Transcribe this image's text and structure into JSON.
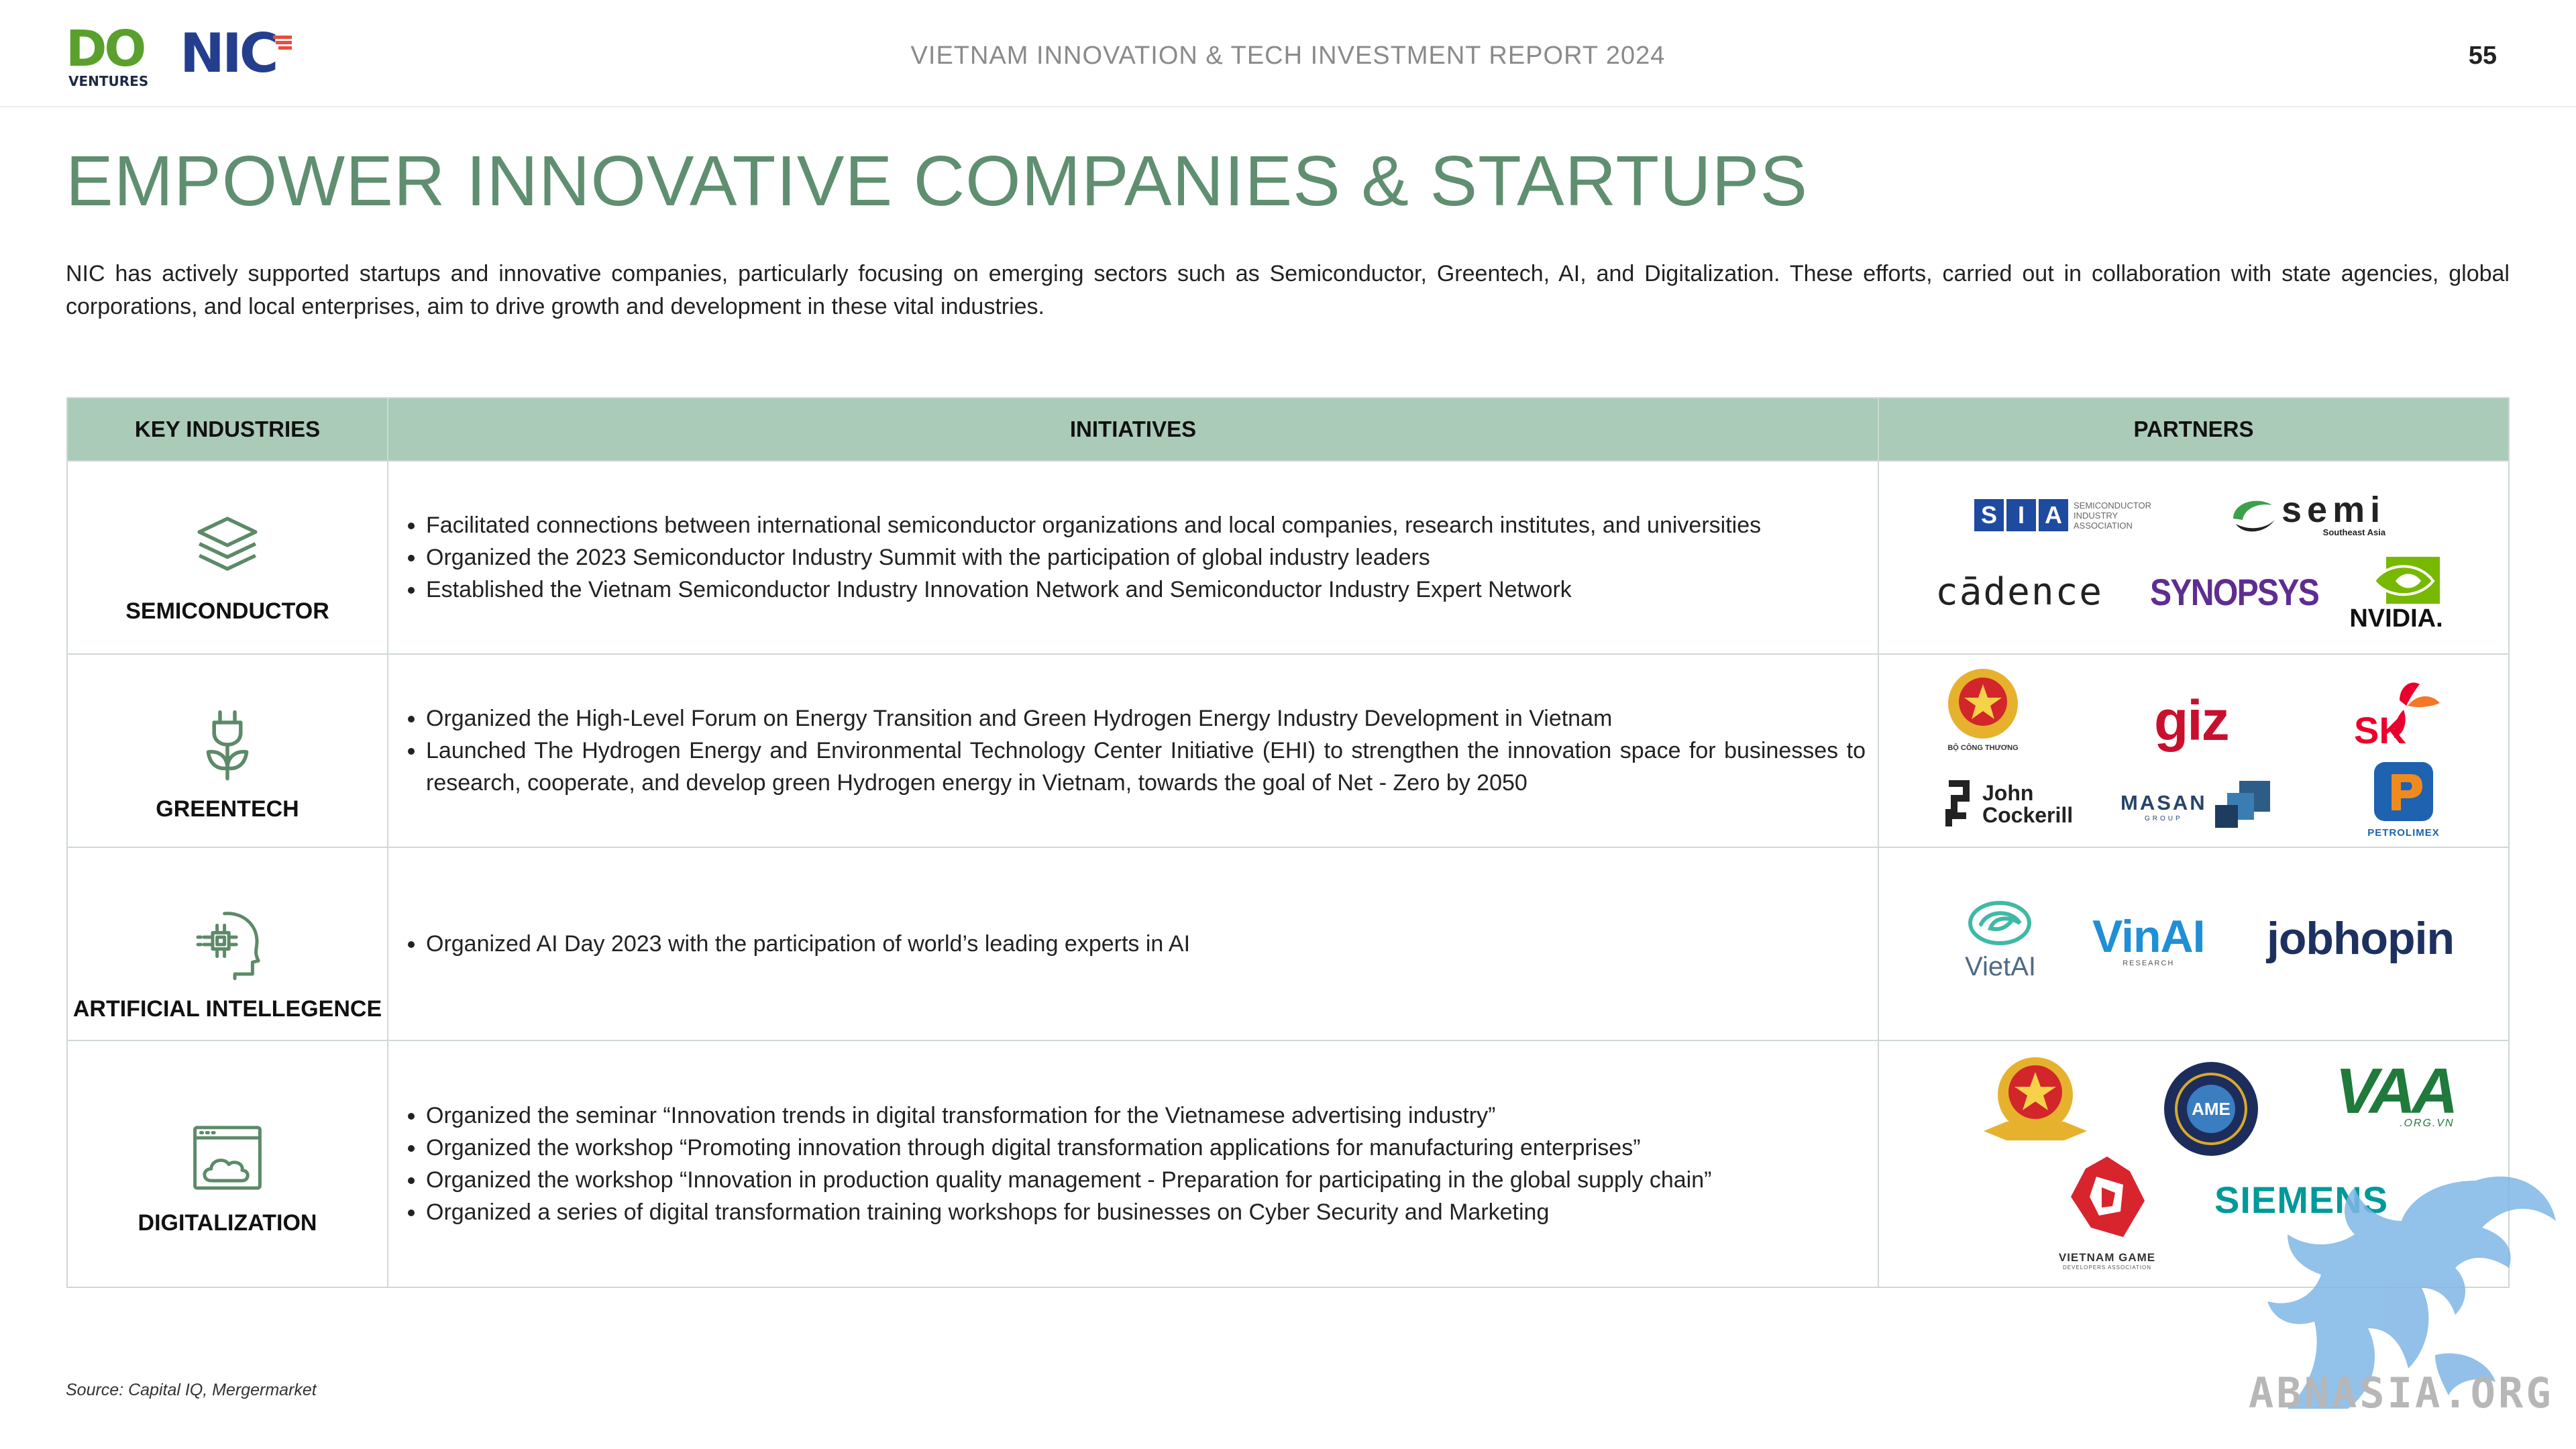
{
  "header": {
    "logo_do": "DO",
    "logo_ventures": "VENTURES",
    "logo_nic": "NIC",
    "report_title": "VIETNAM INNOVATION & TECH INVESTMENT REPORT 2024",
    "page_number": "55"
  },
  "page_title": "EMPOWER INNOVATIVE COMPANIES & STARTUPS",
  "intro": "NIC has actively supported startups and innovative companies, particularly focusing on emerging sectors such as Semiconductor, Greentech, AI, and Digitalization. These efforts, carried out in collaboration with state agencies, global corporations, and local enterprises, aim to drive growth and development in these vital industries.",
  "table": {
    "headers": [
      "KEY INDUSTRIES",
      "INITIATIVES",
      "PARTNERS"
    ],
    "rows": [
      {
        "industry": "SEMICONDUCTOR",
        "icon": "layers-icon",
        "initiatives": [
          "Facilitated connections between international semiconductor organizations and local companies, research institutes, and universities",
          "Organized the 2023 Semiconductor Industry Summit with the participation of global industry leaders",
          "Established the Vietnam Semiconductor Industry Innovation Network and Semiconductor Industry Expert Network"
        ],
        "partners": {
          "sia_letters": [
            "S",
            "I",
            "A"
          ],
          "sia_caption": [
            "SEMICONDUCTOR",
            "INDUSTRY",
            "ASSOCIATION"
          ],
          "semi": "semi",
          "semi_sub": "Southeast Asia",
          "cadence": "cādence",
          "synopsys": "SYNOPSYS",
          "nvidia": "NVIDIA."
        }
      },
      {
        "industry": "GREENTECH",
        "icon": "plug-plant-icon",
        "initiatives": [
          "Organized the High-Level Forum on Energy Transition and Green Hydrogen Energy Industry Development in Vietnam",
          "Launched The Hydrogen Energy and Environmental Technology Center Initiative (EHI) to strengthen the innovation space for businesses to research, cooperate, and develop green Hydrogen energy in Vietnam, towards the goal of Net - Zero by 2050"
        ],
        "partners": {
          "moit_caption": "BỘ CÔNG THƯƠNG",
          "giz": "giz",
          "sk": "SK",
          "john": "John",
          "cockerill": "Cockerill",
          "masan": "MASAN",
          "masan_sub": "GROUP",
          "petrolimex": "PETROLIMEX"
        }
      },
      {
        "industry": "ARTIFICIAL INTELLEGENCE",
        "icon": "ai-head-icon",
        "initiatives": [
          "Organized AI Day 2023 with the participation of world’s leading experts in AI"
        ],
        "partners": {
          "vietai": "VietAI",
          "vinai": "VinAI",
          "vinai_sub": "RESEARCH",
          "jobhopin": "jobhopin"
        }
      },
      {
        "industry": "DIGITALIZATION",
        "icon": "cloud-window-icon",
        "initiatives": [
          "Organized the seminar “Innovation trends in digital transformation for the Vietnamese advertising industry”",
          "Organized the workshop “Promoting innovation through digital transformation applications for manufacturing enterprises”",
          "Organized the workshop “Innovation in production quality management - Preparation for participating in the global supply chain”",
          "Organized a series of digital transformation training workshops for businesses on Cyber Security and Marketing"
        ],
        "partners": {
          "ame": "AME",
          "vaa": "VAA",
          "vaa_sub": ".ORG.VN",
          "siemens": "SIEMENS",
          "vga": "VIETNAM GAME",
          "vga_sub": "DEVELOPERS ASSOCIATION"
        }
      }
    ]
  },
  "source": "Source: Capital IQ, Mergermarket",
  "watermark": "ABNASIA.ORG",
  "colors": {
    "title_green": "#5f8f70",
    "header_fill": "#a9cbb8",
    "icon_green": "#5c8a68"
  }
}
